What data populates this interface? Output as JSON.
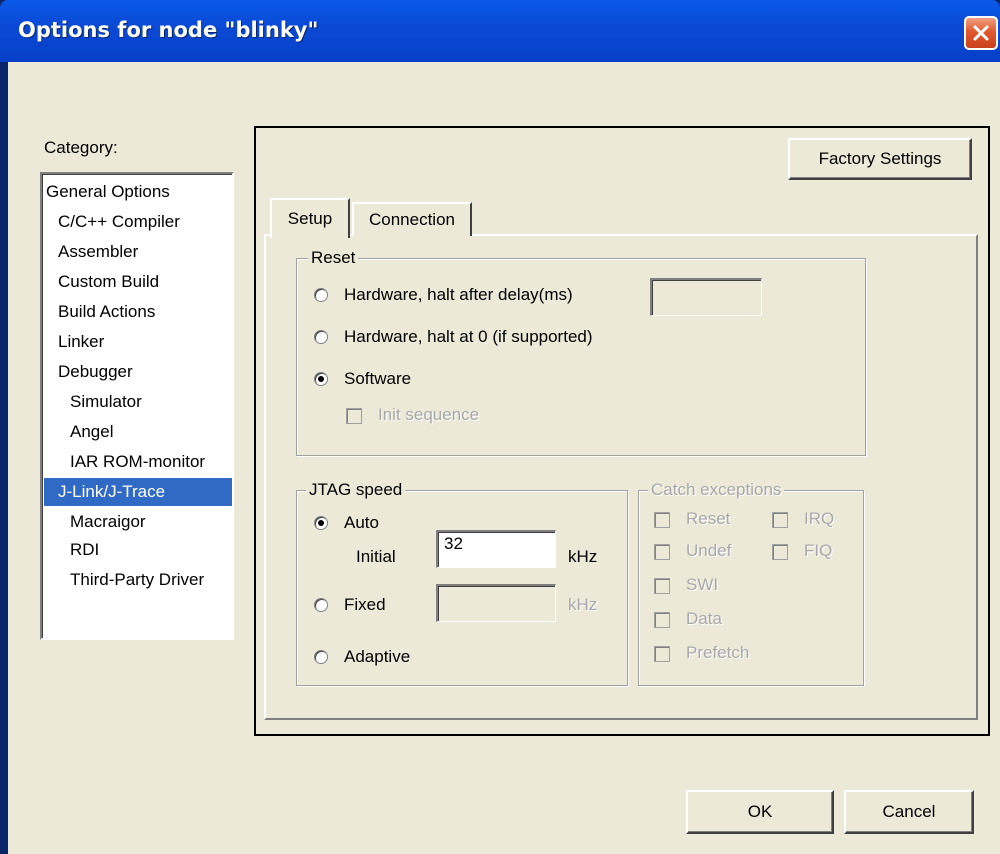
{
  "window": {
    "title": "Options for node \"blinky\""
  },
  "category": {
    "label": "Category:",
    "items": [
      "General Options",
      "C/C++ Compiler",
      "Assembler",
      "Custom Build",
      "Build Actions",
      "Linker",
      "Debugger",
      "Simulator",
      "Angel",
      "IAR ROM-monitor",
      "J-Link/J-Trace",
      "Macraigor",
      "RDI",
      "Third-Party Driver"
    ],
    "selected": "J-Link/J-Trace"
  },
  "toolbar": {
    "factory_settings_label": "Factory Settings"
  },
  "tabs": [
    {
      "label": "Setup",
      "active": true
    },
    {
      "label": "Connection",
      "active": false
    }
  ],
  "reset": {
    "title": "Reset",
    "option_delay": "Hardware, halt after delay(ms)",
    "option_halt0": "Hardware, halt at 0 (if supported)",
    "option_software": "Software",
    "selected": "Software",
    "delay_value": "",
    "init_sequence_label": "Init sequence"
  },
  "jtag": {
    "title": "JTAG speed",
    "auto_label": "Auto",
    "initial_label": "Initial",
    "initial_value": "32",
    "unit": "kHz",
    "fixed_label": "Fixed",
    "fixed_value": "",
    "adaptive_label": "Adaptive",
    "selected": "Auto"
  },
  "catch": {
    "title": "Catch exceptions",
    "reset_label": "Reset",
    "irq_label": "IRQ",
    "undef_label": "Undef",
    "fiq_label": "FIQ",
    "swi_label": "SWI",
    "data_label": "Data",
    "prefetch_label": "Prefetch"
  },
  "footer": {
    "ok_label": "OK",
    "cancel_label": "Cancel"
  },
  "colors": {
    "titlebar": "#0a4ad6",
    "dialog_bg": "#ece9d8",
    "selection": "#316ac5",
    "close_button": "#e05a30"
  }
}
